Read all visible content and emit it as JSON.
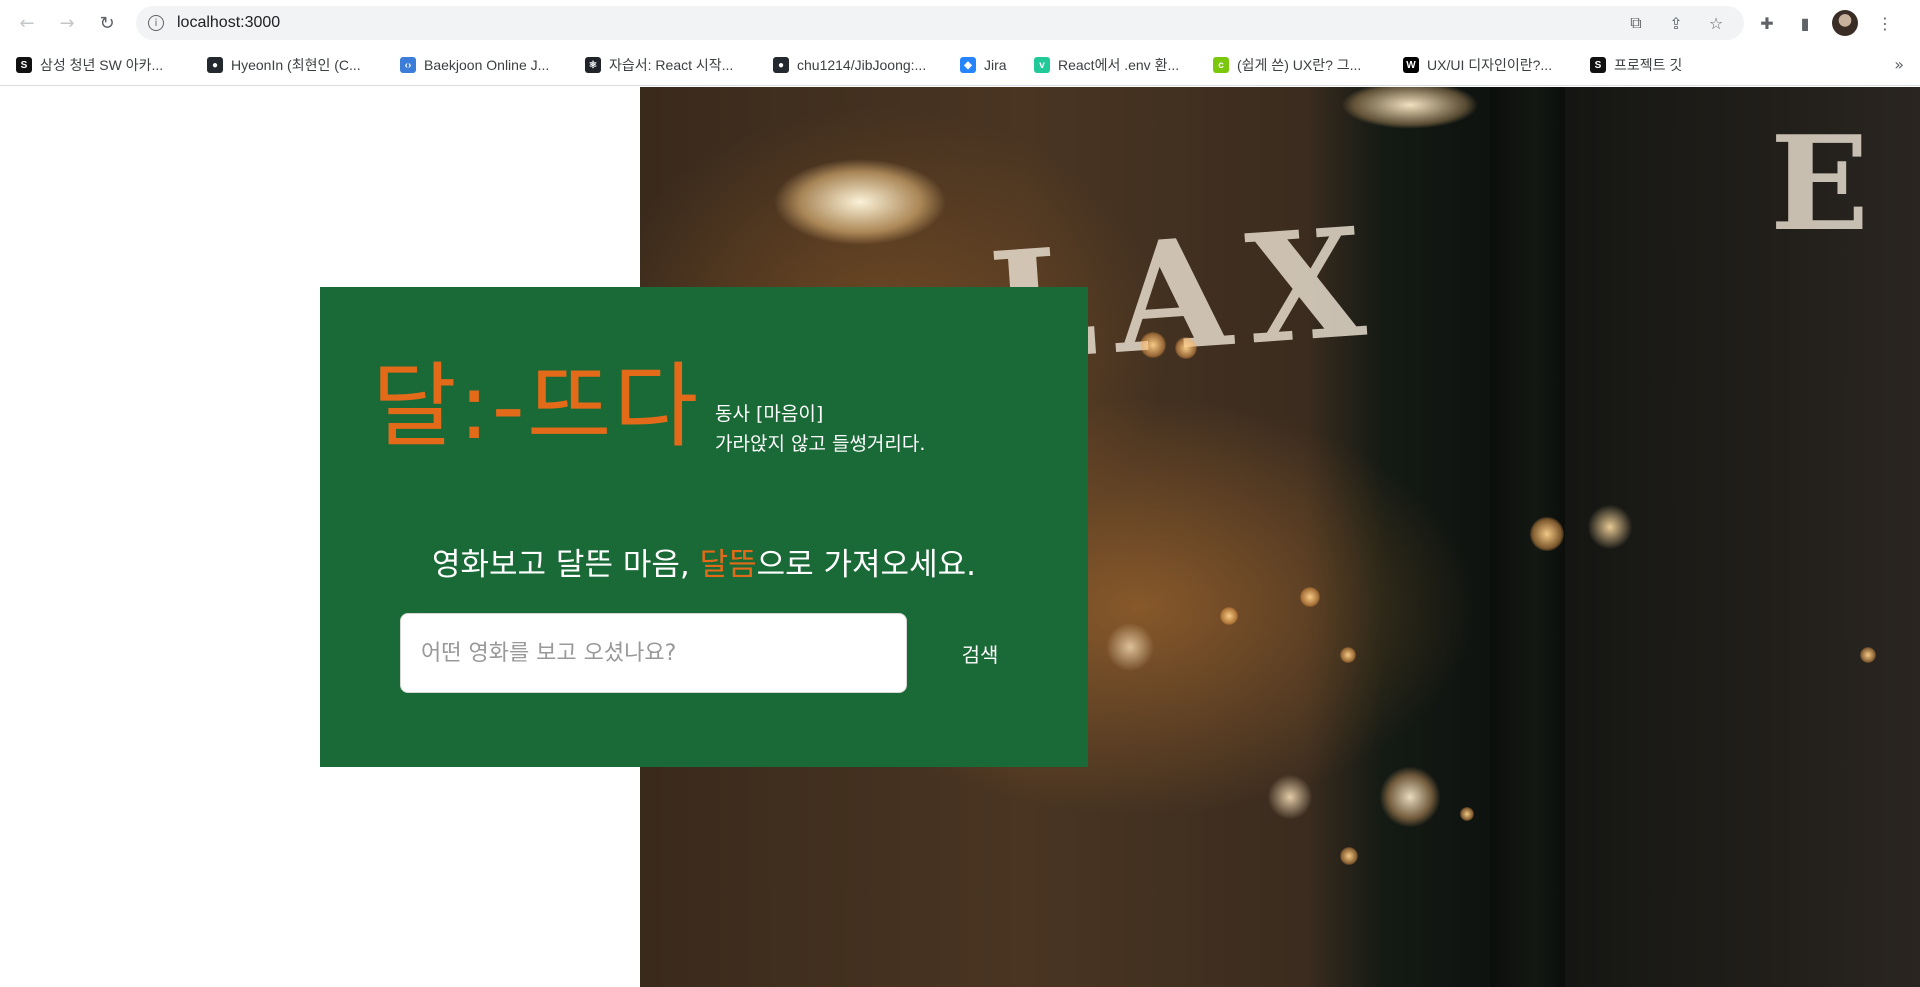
{
  "browser": {
    "url": "localhost:3000",
    "bookmarks": [
      {
        "label": "삼성 청년 SW 아카...",
        "icon": "ssafy-icon",
        "color": "#111111",
        "glyph": "S"
      },
      {
        "label": "HyeonIn (최현인 (C...",
        "icon": "github-icon",
        "color": "#24292f",
        "glyph": "●"
      },
      {
        "label": "Baekjoon Online J...",
        "icon": "code-icon",
        "color": "#3b7dd8",
        "glyph": "‹›"
      },
      {
        "label": "자습서: React 시작...",
        "icon": "react-icon",
        "color": "#20232a",
        "glyph": "⚛"
      },
      {
        "label": "chu1214/JibJoong:...",
        "icon": "github-icon",
        "color": "#24292f",
        "glyph": "●"
      },
      {
        "label": "Jira",
        "icon": "jira-icon",
        "color": "#2684ff",
        "glyph": "◆"
      },
      {
        "label": "React에서 .env 환...",
        "icon": "velog-icon",
        "color": "#20c997",
        "glyph": "v"
      },
      {
        "label": "(쉽게 쓴) UX란? 그...",
        "icon": "c-logo-icon",
        "color": "#7ac70c",
        "glyph": "c"
      },
      {
        "label": "UX/UI 디자인이란?...",
        "icon": "wix-icon",
        "color": "#000000",
        "glyph": "W"
      },
      {
        "label": "프로젝트 깃",
        "icon": "ssafy-icon",
        "color": "#111111",
        "glyph": "S"
      }
    ]
  },
  "hero": {
    "sign_text": "LAX",
    "sign_letter": "E"
  },
  "card": {
    "logo": "달:-뜨다",
    "definition_line1": "동사 [마음이]",
    "definition_line2": "가라앉지 않고 들썽거리다.",
    "tagline_prefix": "영화보고 달뜬 마음, ",
    "tagline_accent": "달뜸",
    "tagline_suffix": "으로 가져오세요.",
    "search_placeholder": "어떤 영화를 보고 오셨나요?",
    "search_button": "검색"
  },
  "colors": {
    "card_bg": "#1a6a37",
    "accent": "#e36a19"
  }
}
